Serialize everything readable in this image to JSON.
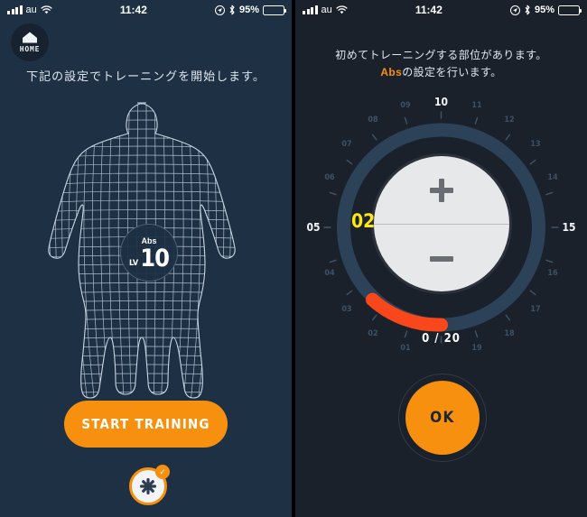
{
  "status_bar": {
    "carrier": "au",
    "time": "11:42",
    "battery_percent": "95%",
    "signal_icon": "cellular-signal-icon",
    "wifi_icon": "wifi-icon",
    "location_icon": "location-arrow-icon",
    "bluetooth_icon": "bluetooth-icon",
    "battery_icon": "battery-icon"
  },
  "left_panel": {
    "home_button": {
      "label": "HOME",
      "icon": "home-icon"
    },
    "lead_text": "下記の設定でトレーニングを開始します。",
    "body_model": {
      "icon": "wireframe-body-model"
    },
    "level_badge": {
      "part": "Abs",
      "lv_prefix": "LV",
      "level": "10"
    },
    "start_button": {
      "label": "START TRAINING"
    },
    "fab": {
      "icon": "pad-icon",
      "badge": "✓"
    }
  },
  "right_panel": {
    "headline_line1": "初めてトレーニングする部位があります。",
    "headline_accent": "Abs",
    "headline_line2": "の設定を行います。",
    "dial": {
      "selected_value": "02",
      "count_label": "0 / 20",
      "max": 20,
      "plus_icon": "plus-icon",
      "minus_icon": "minus-icon",
      "major_ticks": [
        "05",
        "10",
        "15"
      ],
      "minor_ticks": [
        "01",
        "02",
        "03",
        "04",
        "06",
        "07",
        "08",
        "09",
        "11",
        "12",
        "13",
        "14",
        "16",
        "17",
        "18",
        "19"
      ]
    },
    "ok_button": {
      "label": "OK"
    }
  },
  "colors": {
    "left_bg": "#1e3144",
    "right_bg": "#1b212b",
    "accent_orange": "#f7900f",
    "arc_orange": "#f8471a",
    "value_yellow": "#fbe712",
    "track_blue": "#2b4258",
    "dial_white": "#e7e8ea"
  }
}
